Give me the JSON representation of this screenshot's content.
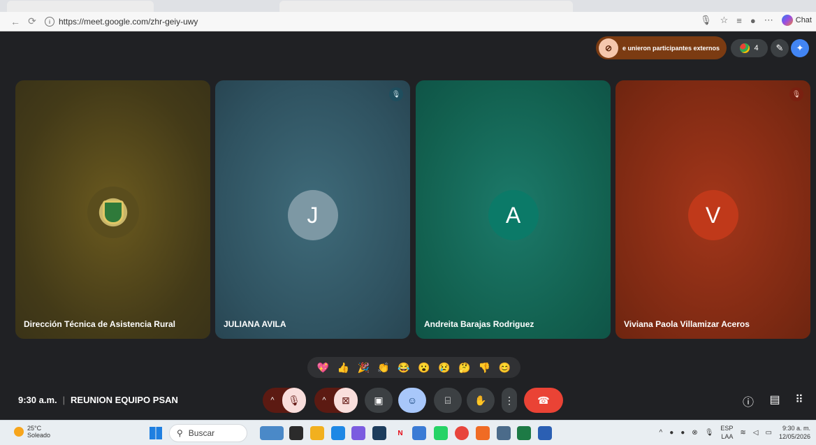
{
  "browser": {
    "url": "https://meet.google.com/zhr-geiy-uwy",
    "chat_label": "Chat"
  },
  "meet": {
    "external_notice": "e unieron participantes externos",
    "people_count": "4",
    "participants": [
      {
        "name": "Dirección Técnica de Asistencia Rural",
        "avatar": "",
        "muted": false
      },
      {
        "name": "JULIANA AVILA",
        "avatar": "J",
        "muted": true
      },
      {
        "name": "Andreita Barajas Rodriguez",
        "avatar": "A",
        "muted": false
      },
      {
        "name": "Viviana Paola Villamizar Aceros",
        "avatar": "V",
        "muted": true
      }
    ],
    "reactions": [
      "💖",
      "👍",
      "🎉",
      "👏",
      "😂",
      "😮",
      "😢",
      "🤔",
      "👎",
      "😊"
    ],
    "time": "9:30 a.m.",
    "separator": "|",
    "meeting_name": "REUNION EQUIPO PSAN"
  },
  "taskbar": {
    "temperature": "25°C",
    "weather": "Soleado",
    "search_placeholder": "Buscar",
    "lang_top": "ESP",
    "lang_bottom": "LAA",
    "clock_time": "9:30 a. m.",
    "clock_date": "12/05/2026"
  }
}
